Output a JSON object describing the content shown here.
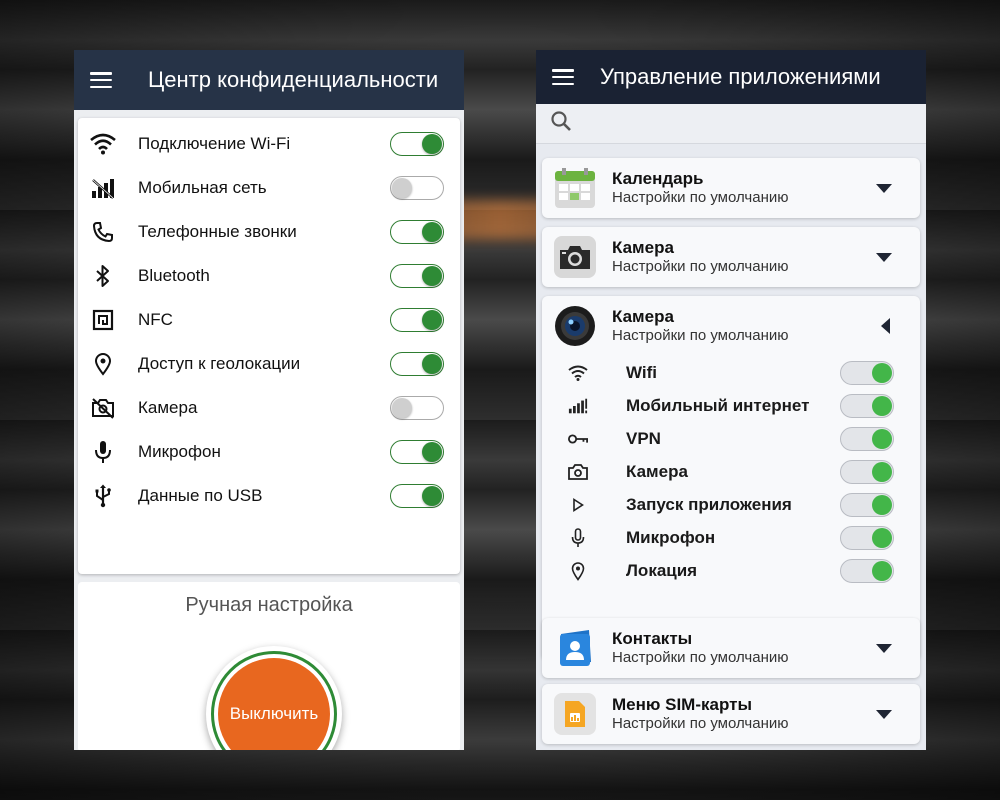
{
  "left": {
    "title": "Центр конфиденциальности",
    "settings": [
      {
        "label": "Подключение Wi-Fi",
        "icon": "wifi-icon",
        "on": true
      },
      {
        "label": "Мобильная сеть",
        "icon": "mobile-network-off-icon",
        "on": false
      },
      {
        "label": "Телефонные звонки",
        "icon": "phone-icon",
        "on": true
      },
      {
        "label": "Bluetooth",
        "icon": "bluetooth-icon",
        "on": true
      },
      {
        "label": "NFC",
        "icon": "nfc-icon",
        "on": true
      },
      {
        "label": "Доступ к геолокации",
        "icon": "location-icon",
        "on": true
      },
      {
        "label": "Камера",
        "icon": "camera-off-icon",
        "on": false
      },
      {
        "label": "Микрофон",
        "icon": "microphone-icon",
        "on": true
      },
      {
        "label": "Данные по USB",
        "icon": "usb-icon",
        "on": true
      }
    ],
    "manual_title": "Ручная настройка",
    "power_label": "Выключить"
  },
  "right": {
    "title": "Управление приложениями",
    "apps": [
      {
        "name": "Календарь",
        "sub": "Настройки по умолчанию",
        "icon": "calendar-icon"
      },
      {
        "name": "Камера",
        "sub": "Настройки по умолчанию",
        "icon": "camera-app-icon"
      },
      {
        "name": "Камера",
        "sub": "Настройки по умолчанию",
        "icon": "camera-lens-icon",
        "expanded": true,
        "permissions": [
          {
            "label": "Wifi",
            "icon": "wifi-icon",
            "on": true
          },
          {
            "label": "Мобильный интернет",
            "icon": "signal-icon",
            "on": true
          },
          {
            "label": "VPN",
            "icon": "key-icon",
            "on": true
          },
          {
            "label": "Камера",
            "icon": "camera-icon",
            "on": true
          },
          {
            "label": "Запуск приложения",
            "icon": "play-icon",
            "on": true
          },
          {
            "label": "Микрофон",
            "icon": "microphone-icon",
            "on": true
          },
          {
            "label": "Локация",
            "icon": "location-icon",
            "on": true
          }
        ]
      },
      {
        "name": "Контакты",
        "sub": "Настройки по умолчанию",
        "icon": "contacts-icon"
      },
      {
        "name": "Меню SIM-карты",
        "sub": "Настройки по умолчанию",
        "icon": "sim-card-icon"
      }
    ]
  },
  "colors": {
    "accent_green": "#2e8b36",
    "power_orange": "#e8671f",
    "header_dark": "#263347"
  }
}
